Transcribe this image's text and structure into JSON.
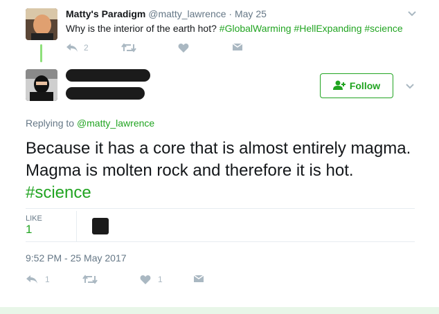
{
  "parent_tweet": {
    "author_name": "Matty's Paradigm",
    "handle": "@matty_lawrence",
    "separator": "·",
    "date": "May 25",
    "text_prefix": "Why is the interior of the earth hot? ",
    "hashtags": [
      "#GlobalWarming",
      "#HellExpanding",
      "#science"
    ],
    "reply_count": "2",
    "icons": [
      "reply-icon",
      "retweet-icon",
      "like-icon",
      "direct-message-icon",
      "chevron-down-icon"
    ]
  },
  "main_tweet": {
    "follow_label": "Follow",
    "replying_label": "Replying to",
    "replying_handle": "@matty_lawrence",
    "text": "Because it has a core that is almost entirely magma. Magma is molten rock and therefore it is hot. ",
    "hashtag": "#science",
    "like_label": "LIKE",
    "like_count": "1",
    "timestamp": "9:52 PM - 25 May 2017",
    "reply_count": "1",
    "like_action_count": "1"
  },
  "colors": {
    "accent": "#21a421",
    "muted": "#657786",
    "icon": "#aab8c2",
    "thread_line": "#8ee07a"
  }
}
